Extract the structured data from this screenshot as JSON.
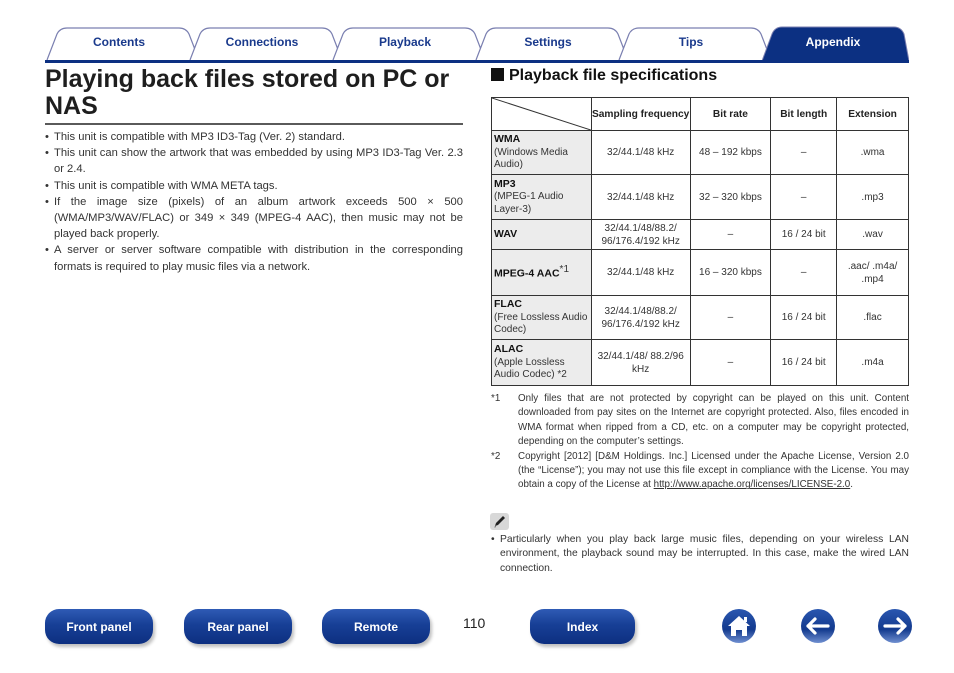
{
  "tabs": [
    {
      "label": "Contents",
      "active": false
    },
    {
      "label": "Connections",
      "active": false
    },
    {
      "label": "Playback",
      "active": false
    },
    {
      "label": "Settings",
      "active": false
    },
    {
      "label": "Tips",
      "active": false
    },
    {
      "label": "Appendix",
      "active": true
    }
  ],
  "colors": {
    "brand": "#0c3082",
    "tab_outline": "#7a7fb0",
    "active_tab": "#0c3082"
  },
  "page": {
    "title": "Playing back files stored on PC or NAS",
    "bullets": [
      "This unit is compatible with MP3 ID3-Tag (Ver. 2) standard.",
      "This unit can show the artwork that was embedded by using MP3 ID3-Tag Ver. 2.3 or 2.4.",
      "This unit is compatible with WMA META tags.",
      "If the image size (pixels) of an album artwork exceeds 500 × 500 (WMA/MP3/WAV/FLAC) or 349 × 349 (MPEG-4 AAC), then music may not be played back properly.",
      "A server or server software compatible with distribution in the corresponding formats is required to play music files via a network."
    ]
  },
  "spec": {
    "heading": "Playback file specifications",
    "headers": [
      "Sampling frequency",
      "Bit rate",
      "Bit length",
      "Extension"
    ],
    "rows": [
      {
        "name": "WMA",
        "desc": "(Windows Media Audio)",
        "note": "",
        "freq": "32/44.1/48 kHz",
        "bitrate": "48 – 192 kbps",
        "bitlen": "–",
        "ext": ".wma"
      },
      {
        "name": "MP3",
        "desc": "(MPEG-1 Audio Layer-3)",
        "note": "",
        "freq": "32/44.1/48 kHz",
        "bitrate": "32 – 320 kbps",
        "bitlen": "–",
        "ext": ".mp3"
      },
      {
        "name": "WAV",
        "desc": "",
        "note": "",
        "freq": "32/44.1/48/88.2/ 96/176.4/192 kHz",
        "bitrate": "–",
        "bitlen": "16 / 24 bit",
        "ext": ".wav"
      },
      {
        "name": "MPEG-4 AAC",
        "desc": "",
        "note": "*1",
        "freq": "32/44.1/48 kHz",
        "bitrate": "16 – 320 kbps",
        "bitlen": "–",
        "ext": ".aac/ .m4a/ .mp4"
      },
      {
        "name": "FLAC",
        "desc": "(Free Lossless Audio Codec)",
        "note": "",
        "freq": "32/44.1/48/88.2/ 96/176.4/192 kHz",
        "bitrate": "–",
        "bitlen": "16 / 24 bit",
        "ext": ".flac"
      },
      {
        "name": "ALAC",
        "desc": "(Apple Lossless Audio Codec)",
        "note": "*2",
        "freq": "32/44.1/48/ 88.2/96 kHz",
        "bitrate": "–",
        "bitlen": "16 / 24 bit",
        "ext": ".m4a"
      }
    ]
  },
  "notes": [
    {
      "mark": "*1",
      "text": "Only files that are not protected by copyright can be played on this unit. Content downloaded from pay sites on the Internet are copyright protected. Also, files encoded in WMA format when ripped from a CD, etc. on a computer may be copyright protected, depending on the computer’s settings.",
      "link": ""
    },
    {
      "mark": "*2",
      "text": "Copyright [2012] [D&M Holdings. Inc.] Licensed under the Apache License, Version 2.0 (the “License”); you may not use this file except in compliance with the License. You may obtain a copy of the License at ",
      "link": "http://www.apache.org/licenses/LICENSE-2.0",
      "after": "."
    }
  ],
  "tip": {
    "icon": "pencil-icon",
    "text": "Particularly when you play back large music files, depending on your wireless LAN environment, the playback sound may be interrupted. In this case, make the wired LAN connection."
  },
  "footer": {
    "buttons": [
      "Front panel",
      "Rear panel",
      "Remote",
      "Index"
    ],
    "page_number": "110",
    "icons": [
      "home-icon",
      "back-arrow-icon",
      "forward-arrow-icon"
    ]
  }
}
